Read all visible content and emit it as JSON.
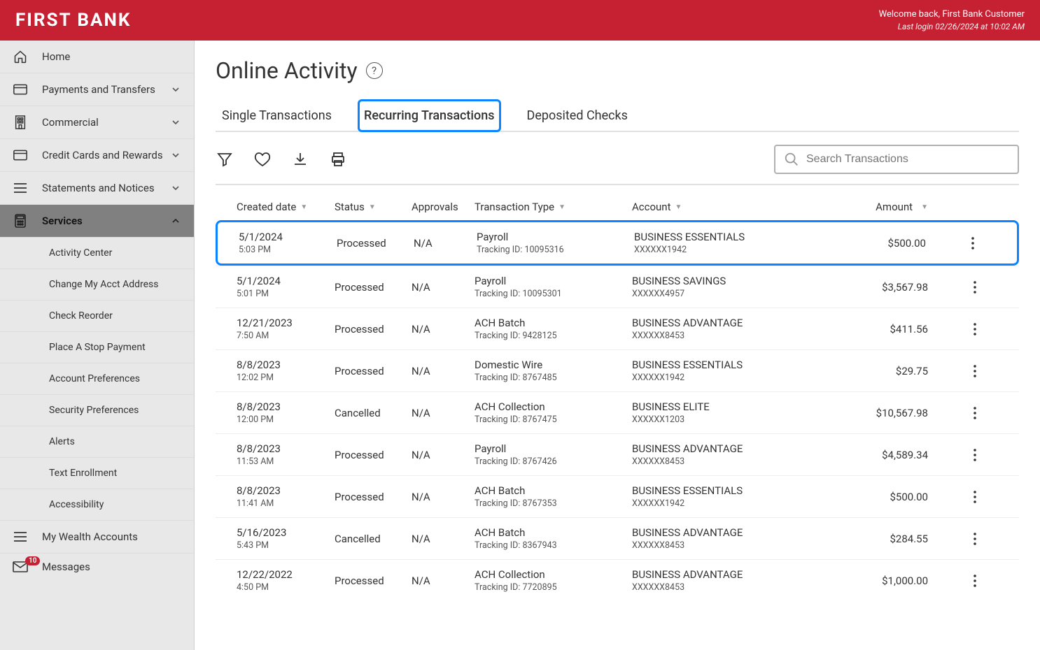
{
  "header": {
    "logo": "FIRST BANK",
    "welcome": "Welcome back, First Bank Customer",
    "last_login": "Last login 02/26/2024 at 10:02 AM"
  },
  "sidebar": {
    "items": [
      {
        "label": "Home",
        "icon": "home",
        "expandable": false
      },
      {
        "label": "Payments and Transfers",
        "icon": "card",
        "expandable": true
      },
      {
        "label": "Commercial",
        "icon": "building",
        "expandable": true
      },
      {
        "label": "Credit Cards and Rewards",
        "icon": "card",
        "expandable": true
      },
      {
        "label": "Statements and Notices",
        "icon": "menu",
        "expandable": true
      },
      {
        "label": "Services",
        "icon": "calculator",
        "expandable": true,
        "active": true
      }
    ],
    "services_sub": [
      "Activity Center",
      "Change My Acct Address",
      "Check Reorder",
      "Place A Stop Payment",
      "Account Preferences",
      "Security Preferences",
      "Alerts",
      "Text Enrollment",
      "Accessibility"
    ],
    "wealth": "My Wealth Accounts",
    "messages": "Messages",
    "messages_count": "10"
  },
  "page": {
    "title": "Online Activity",
    "tabs": [
      "Single Transactions",
      "Recurring Transactions",
      "Deposited Checks"
    ],
    "active_tab": 1,
    "search_placeholder": "Search Transactions"
  },
  "columns": {
    "date": "Created date",
    "status": "Status",
    "approvals": "Approvals",
    "type": "Transaction Type",
    "account": "Account",
    "amount": "Amount"
  },
  "rows": [
    {
      "date": "5/1/2024",
      "time": "5:03 PM",
      "status": "Processed",
      "approvals": "N/A",
      "type": "Payroll",
      "tracking": "Tracking ID: 10095316",
      "account": "BUSINESS ESSENTIALS",
      "acct_mask": "XXXXXX1942",
      "amount": "$500.00",
      "highlight": true
    },
    {
      "date": "5/1/2024",
      "time": "5:01 PM",
      "status": "Processed",
      "approvals": "N/A",
      "type": "Payroll",
      "tracking": "Tracking ID: 10095301",
      "account": "BUSINESS SAVINGS",
      "acct_mask": "XXXXXX4957",
      "amount": "$3,567.98"
    },
    {
      "date": "12/21/2023",
      "time": "7:50 AM",
      "status": "Processed",
      "approvals": "N/A",
      "type": "ACH Batch",
      "tracking": "Tracking ID: 9428125",
      "account": "BUSINESS ADVANTAGE",
      "acct_mask": "XXXXXX8453",
      "amount": "$411.56"
    },
    {
      "date": "8/8/2023",
      "time": "12:02 PM",
      "status": "Processed",
      "approvals": "N/A",
      "type": "Domestic Wire",
      "tracking": "Tracking ID: 8767485",
      "account": "BUSINESS ESSENTIALS",
      "acct_mask": "XXXXXX1942",
      "amount": "$29.75"
    },
    {
      "date": "8/8/2023",
      "time": "12:00 PM",
      "status": "Cancelled",
      "approvals": "N/A",
      "type": "ACH Collection",
      "tracking": "Tracking ID: 8767475",
      "account": "BUSINESS ELITE",
      "acct_mask": "XXXXXX1203",
      "amount": "$10,567.98"
    },
    {
      "date": "8/8/2023",
      "time": "11:53 AM",
      "status": "Processed",
      "approvals": "N/A",
      "type": "Payroll",
      "tracking": "Tracking ID: 8767426",
      "account": "BUSINESS ADVANTAGE",
      "acct_mask": "XXXXXX8453",
      "amount": "$4,589.34"
    },
    {
      "date": "8/8/2023",
      "time": "11:41 AM",
      "status": "Processed",
      "approvals": "N/A",
      "type": "ACH Batch",
      "tracking": "Tracking ID: 8767353",
      "account": "BUSINESS ESSENTIALS",
      "acct_mask": "XXXXXX1942",
      "amount": "$500.00"
    },
    {
      "date": "5/16/2023",
      "time": "5:43 PM",
      "status": "Cancelled",
      "approvals": "N/A",
      "type": "ACH Batch",
      "tracking": "Tracking ID: 8367943",
      "account": "BUSINESS ADVANTAGE",
      "acct_mask": "XXXXXX8453",
      "amount": "$284.55"
    },
    {
      "date": "12/22/2022",
      "time": "4:50 PM",
      "status": "Processed",
      "approvals": "N/A",
      "type": "ACH Collection",
      "tracking": "Tracking ID: 7720895",
      "account": "BUSINESS ADVANTAGE",
      "acct_mask": "XXXXXX8453",
      "amount": "$1,000.00"
    }
  ]
}
